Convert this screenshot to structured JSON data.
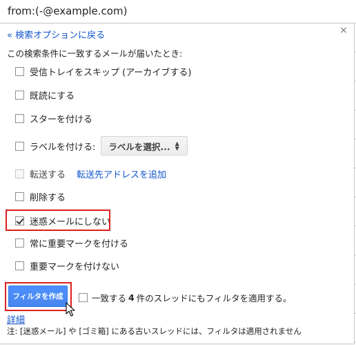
{
  "search": {
    "query": "from:(-@example.com)"
  },
  "panel": {
    "back_link": "« 検索オプションに戻る",
    "close_label": "×",
    "intro": "この検索条件に一致するメールが届いたとき:",
    "options": {
      "skip_inbox": {
        "label": "受信トレイをスキップ (アーカイブする)",
        "checked": false
      },
      "mark_read": {
        "label": "既読にする",
        "checked": false
      },
      "star": {
        "label": "スターを付ける",
        "checked": false
      },
      "apply_label": {
        "label": "ラベルを付ける:",
        "checked": false,
        "select_value": "ラベルを選択..."
      },
      "forward": {
        "label": "転送する",
        "checked": false,
        "disabled": true,
        "link": "転送先アドレスを追加"
      },
      "delete": {
        "label": "削除する",
        "checked": false
      },
      "never_spam": {
        "label": "迷惑メールにしない",
        "checked": true
      },
      "always_important": {
        "label": "常に重要マークを付ける",
        "checked": false
      },
      "never_important": {
        "label": "重要マークを付けない",
        "checked": false
      }
    },
    "create_button": "フィルタを作成",
    "apply_existing": {
      "pre": "一致する",
      "count": "4",
      "post": "件のスレッドにもフィルタを適用する。",
      "checked": false
    },
    "details_link": "詳細",
    "note": "注: [迷惑メール] や [ゴミ箱] にある古いスレッドには、フィルタは適用されません"
  },
  "colors": {
    "link": "#1155cc",
    "highlight": "#dd1f1f",
    "primary_button": "#4d90fe"
  }
}
